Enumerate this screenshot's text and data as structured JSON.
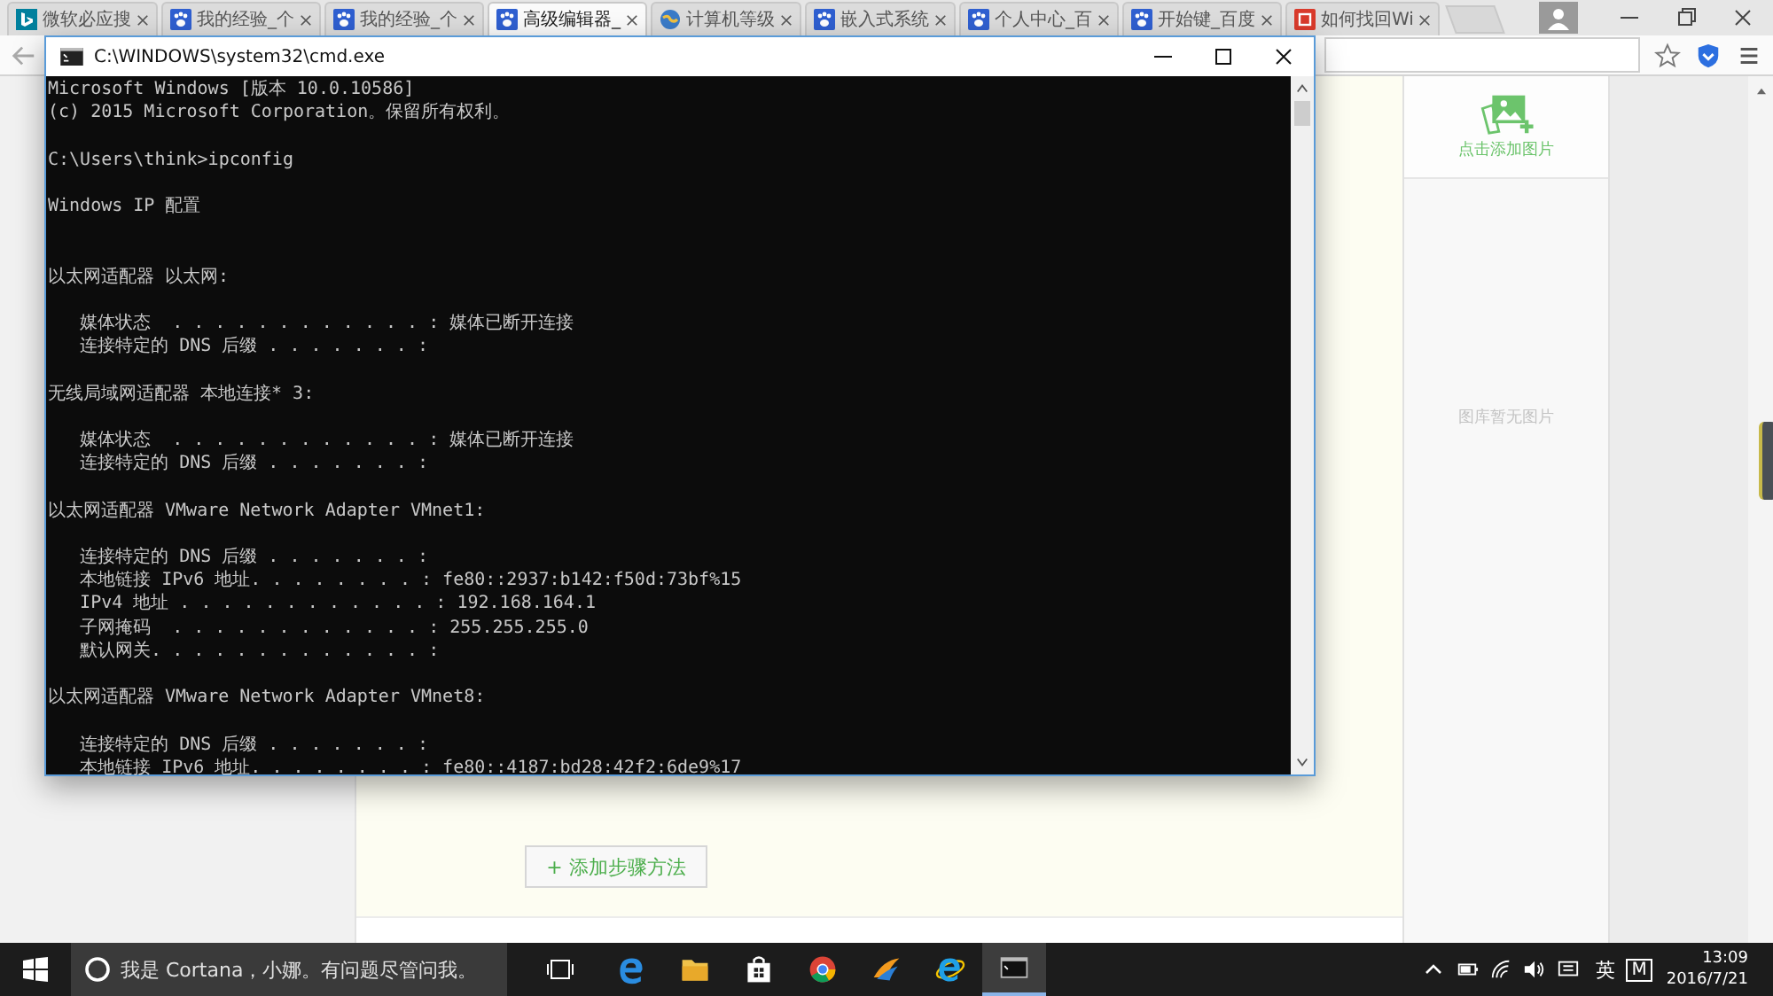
{
  "browser": {
    "tabs": [
      {
        "label": "微软必应搜",
        "kind": "bing",
        "selected": false
      },
      {
        "label": "我的经验_个",
        "kind": "paw",
        "selected": false
      },
      {
        "label": "我的经验_个",
        "kind": "paw",
        "selected": false
      },
      {
        "label": "高级编辑器_",
        "kind": "paw",
        "selected": true
      },
      {
        "label": "计算机等级",
        "kind": "globe",
        "selected": false
      },
      {
        "label": "嵌入式系统",
        "kind": "paw",
        "selected": false
      },
      {
        "label": "个人中心_百",
        "kind": "paw",
        "selected": false
      },
      {
        "label": "开始键_百度",
        "kind": "paw",
        "selected": false
      },
      {
        "label": "如何找回Wi",
        "kind": "square",
        "selected": false
      }
    ]
  },
  "editor": {
    "add_image": "点击添加图片",
    "gallery_empty": "图库暂无图片",
    "add_step_button": "+ 添加步骤方法"
  },
  "console": {
    "title": "C:\\WINDOWS\\system32\\cmd.exe",
    "lines": [
      {
        "kind": "text",
        "text": "Microsoft Windows [版本 10.0.10586]"
      },
      {
        "kind": "text",
        "text": "(c) 2015 Microsoft Corporation。保留所有权利。"
      },
      {
        "kind": "blank"
      },
      {
        "kind": "text",
        "text": "C:\\Users\\think>ipconfig"
      },
      {
        "kind": "blank"
      },
      {
        "kind": "text",
        "text": "Windows IP 配置"
      },
      {
        "kind": "blank"
      },
      {
        "kind": "blank"
      },
      {
        "kind": "text",
        "text": "以太网适配器 以太网:"
      },
      {
        "kind": "blank"
      },
      {
        "kind": "text",
        "text": "   媒体状态  . . . . . . . . . . . . : 媒体已断开连接"
      },
      {
        "kind": "text",
        "text": "   连接特定的 DNS 后缀 . . . . . . . :"
      },
      {
        "kind": "blank"
      },
      {
        "kind": "text",
        "text": "无线局域网适配器 本地连接* 3:"
      },
      {
        "kind": "blank"
      },
      {
        "kind": "text",
        "text": "   媒体状态  . . . . . . . . . . . . : 媒体已断开连接"
      },
      {
        "kind": "text",
        "text": "   连接特定的 DNS 后缀 . . . . . . . :"
      },
      {
        "kind": "blank"
      },
      {
        "kind": "text",
        "text": "以太网适配器 VMware Network Adapter VMnet1:"
      },
      {
        "kind": "blank"
      },
      {
        "kind": "text",
        "text": "   连接特定的 DNS 后缀 . . . . . . . :"
      },
      {
        "kind": "text",
        "text": "   本地链接 IPv6 地址. . . . . . . . : fe80::2937:b142:f50d:73bf%15"
      },
      {
        "kind": "text",
        "text": "   IPv4 地址 . . . . . . . . . . . . : 192.168.164.1"
      },
      {
        "kind": "text",
        "text": "   子网掩码  . . . . . . . . . . . . : 255.255.255.0"
      },
      {
        "kind": "text",
        "text": "   默认网关. . . . . . . . . . . . . :"
      },
      {
        "kind": "blank"
      },
      {
        "kind": "text",
        "text": "以太网适配器 VMware Network Adapter VMnet8:"
      },
      {
        "kind": "blank"
      },
      {
        "kind": "text",
        "text": "   连接特定的 DNS 后缀 . . . . . . . :"
      },
      {
        "kind": "text",
        "text": "   本地链接 IPv6 地址. . . . . . . . : fe80::4187:bd28:42f2:6de9%17"
      }
    ]
  },
  "taskbar": {
    "search_placeholder": "我是 Cortana，小娜。有问题尽管问我。",
    "apps": [
      {
        "kind": "edge",
        "selected": false
      },
      {
        "kind": "folder",
        "selected": false
      },
      {
        "kind": "store",
        "selected": false
      },
      {
        "kind": "chrome",
        "selected": false
      },
      {
        "kind": "wing",
        "selected": false
      },
      {
        "kind": "ie",
        "selected": false
      },
      {
        "kind": "console",
        "selected": true
      }
    ],
    "ime": "英",
    "ime_mode": "M",
    "time": "13:09",
    "date": "2016/7/21"
  }
}
